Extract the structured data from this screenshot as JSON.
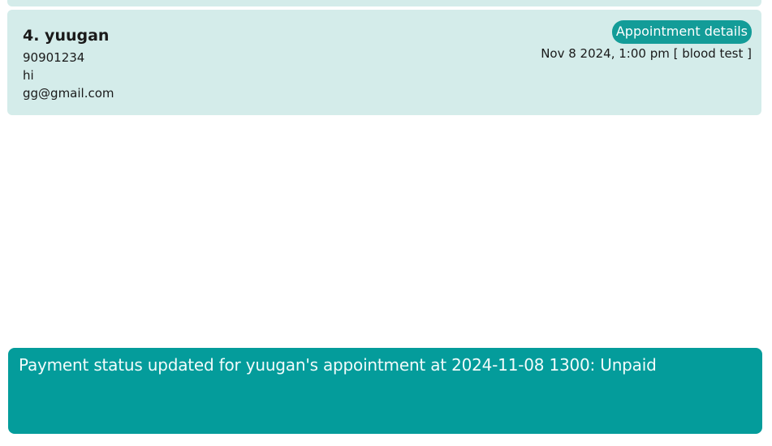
{
  "person": {
    "index_name": "4. yuugan",
    "phone": "90901234",
    "address": "hi",
    "email": "gg@gmail.com",
    "appointment_button_label": "Appointment details",
    "appointment_text": "Nov 8 2024, 1:00 pm [ blood test ]"
  },
  "result_display": {
    "message": "Payment status updated for yuugan's appointment at 2024-11-08 1300: Unpaid"
  },
  "colors": {
    "card_background": "#d4ecea",
    "accent": "#139c98",
    "result_background": "#049c9b"
  }
}
